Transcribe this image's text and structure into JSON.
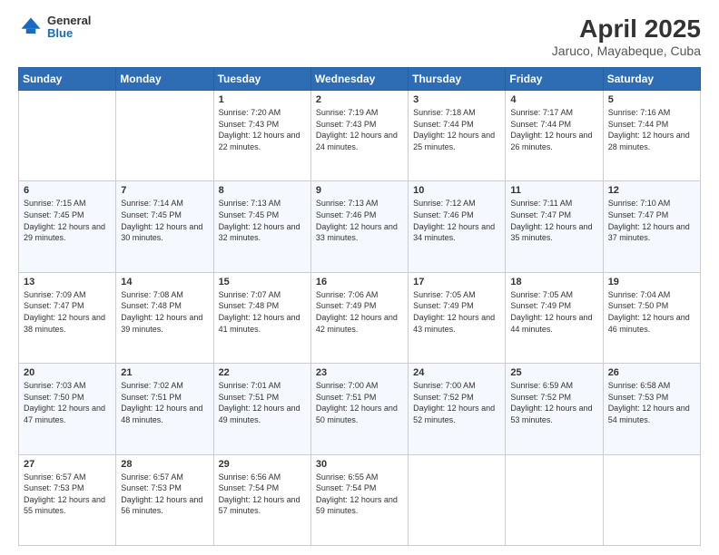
{
  "header": {
    "logo": {
      "general": "General",
      "blue": "Blue"
    },
    "title": "April 2025",
    "subtitle": "Jaruco, Mayabeque, Cuba"
  },
  "calendar": {
    "days_of_week": [
      "Sunday",
      "Monday",
      "Tuesday",
      "Wednesday",
      "Thursday",
      "Friday",
      "Saturday"
    ],
    "weeks": [
      [
        {
          "day": null,
          "sunrise": null,
          "sunset": null,
          "daylight": null
        },
        {
          "day": null,
          "sunrise": null,
          "sunset": null,
          "daylight": null
        },
        {
          "day": "1",
          "sunrise": "Sunrise: 7:20 AM",
          "sunset": "Sunset: 7:43 PM",
          "daylight": "Daylight: 12 hours and 22 minutes."
        },
        {
          "day": "2",
          "sunrise": "Sunrise: 7:19 AM",
          "sunset": "Sunset: 7:43 PM",
          "daylight": "Daylight: 12 hours and 24 minutes."
        },
        {
          "day": "3",
          "sunrise": "Sunrise: 7:18 AM",
          "sunset": "Sunset: 7:44 PM",
          "daylight": "Daylight: 12 hours and 25 minutes."
        },
        {
          "day": "4",
          "sunrise": "Sunrise: 7:17 AM",
          "sunset": "Sunset: 7:44 PM",
          "daylight": "Daylight: 12 hours and 26 minutes."
        },
        {
          "day": "5",
          "sunrise": "Sunrise: 7:16 AM",
          "sunset": "Sunset: 7:44 PM",
          "daylight": "Daylight: 12 hours and 28 minutes."
        }
      ],
      [
        {
          "day": "6",
          "sunrise": "Sunrise: 7:15 AM",
          "sunset": "Sunset: 7:45 PM",
          "daylight": "Daylight: 12 hours and 29 minutes."
        },
        {
          "day": "7",
          "sunrise": "Sunrise: 7:14 AM",
          "sunset": "Sunset: 7:45 PM",
          "daylight": "Daylight: 12 hours and 30 minutes."
        },
        {
          "day": "8",
          "sunrise": "Sunrise: 7:13 AM",
          "sunset": "Sunset: 7:45 PM",
          "daylight": "Daylight: 12 hours and 32 minutes."
        },
        {
          "day": "9",
          "sunrise": "Sunrise: 7:13 AM",
          "sunset": "Sunset: 7:46 PM",
          "daylight": "Daylight: 12 hours and 33 minutes."
        },
        {
          "day": "10",
          "sunrise": "Sunrise: 7:12 AM",
          "sunset": "Sunset: 7:46 PM",
          "daylight": "Daylight: 12 hours and 34 minutes."
        },
        {
          "day": "11",
          "sunrise": "Sunrise: 7:11 AM",
          "sunset": "Sunset: 7:47 PM",
          "daylight": "Daylight: 12 hours and 35 minutes."
        },
        {
          "day": "12",
          "sunrise": "Sunrise: 7:10 AM",
          "sunset": "Sunset: 7:47 PM",
          "daylight": "Daylight: 12 hours and 37 minutes."
        }
      ],
      [
        {
          "day": "13",
          "sunrise": "Sunrise: 7:09 AM",
          "sunset": "Sunset: 7:47 PM",
          "daylight": "Daylight: 12 hours and 38 minutes."
        },
        {
          "day": "14",
          "sunrise": "Sunrise: 7:08 AM",
          "sunset": "Sunset: 7:48 PM",
          "daylight": "Daylight: 12 hours and 39 minutes."
        },
        {
          "day": "15",
          "sunrise": "Sunrise: 7:07 AM",
          "sunset": "Sunset: 7:48 PM",
          "daylight": "Daylight: 12 hours and 41 minutes."
        },
        {
          "day": "16",
          "sunrise": "Sunrise: 7:06 AM",
          "sunset": "Sunset: 7:49 PM",
          "daylight": "Daylight: 12 hours and 42 minutes."
        },
        {
          "day": "17",
          "sunrise": "Sunrise: 7:05 AM",
          "sunset": "Sunset: 7:49 PM",
          "daylight": "Daylight: 12 hours and 43 minutes."
        },
        {
          "day": "18",
          "sunrise": "Sunrise: 7:05 AM",
          "sunset": "Sunset: 7:49 PM",
          "daylight": "Daylight: 12 hours and 44 minutes."
        },
        {
          "day": "19",
          "sunrise": "Sunrise: 7:04 AM",
          "sunset": "Sunset: 7:50 PM",
          "daylight": "Daylight: 12 hours and 46 minutes."
        }
      ],
      [
        {
          "day": "20",
          "sunrise": "Sunrise: 7:03 AM",
          "sunset": "Sunset: 7:50 PM",
          "daylight": "Daylight: 12 hours and 47 minutes."
        },
        {
          "day": "21",
          "sunrise": "Sunrise: 7:02 AM",
          "sunset": "Sunset: 7:51 PM",
          "daylight": "Daylight: 12 hours and 48 minutes."
        },
        {
          "day": "22",
          "sunrise": "Sunrise: 7:01 AM",
          "sunset": "Sunset: 7:51 PM",
          "daylight": "Daylight: 12 hours and 49 minutes."
        },
        {
          "day": "23",
          "sunrise": "Sunrise: 7:00 AM",
          "sunset": "Sunset: 7:51 PM",
          "daylight": "Daylight: 12 hours and 50 minutes."
        },
        {
          "day": "24",
          "sunrise": "Sunrise: 7:00 AM",
          "sunset": "Sunset: 7:52 PM",
          "daylight": "Daylight: 12 hours and 52 minutes."
        },
        {
          "day": "25",
          "sunrise": "Sunrise: 6:59 AM",
          "sunset": "Sunset: 7:52 PM",
          "daylight": "Daylight: 12 hours and 53 minutes."
        },
        {
          "day": "26",
          "sunrise": "Sunrise: 6:58 AM",
          "sunset": "Sunset: 7:53 PM",
          "daylight": "Daylight: 12 hours and 54 minutes."
        }
      ],
      [
        {
          "day": "27",
          "sunrise": "Sunrise: 6:57 AM",
          "sunset": "Sunset: 7:53 PM",
          "daylight": "Daylight: 12 hours and 55 minutes."
        },
        {
          "day": "28",
          "sunrise": "Sunrise: 6:57 AM",
          "sunset": "Sunset: 7:53 PM",
          "daylight": "Daylight: 12 hours and 56 minutes."
        },
        {
          "day": "29",
          "sunrise": "Sunrise: 6:56 AM",
          "sunset": "Sunset: 7:54 PM",
          "daylight": "Daylight: 12 hours and 57 minutes."
        },
        {
          "day": "30",
          "sunrise": "Sunrise: 6:55 AM",
          "sunset": "Sunset: 7:54 PM",
          "daylight": "Daylight: 12 hours and 59 minutes."
        },
        {
          "day": null,
          "sunrise": null,
          "sunset": null,
          "daylight": null
        },
        {
          "day": null,
          "sunrise": null,
          "sunset": null,
          "daylight": null
        },
        {
          "day": null,
          "sunrise": null,
          "sunset": null,
          "daylight": null
        }
      ]
    ]
  }
}
